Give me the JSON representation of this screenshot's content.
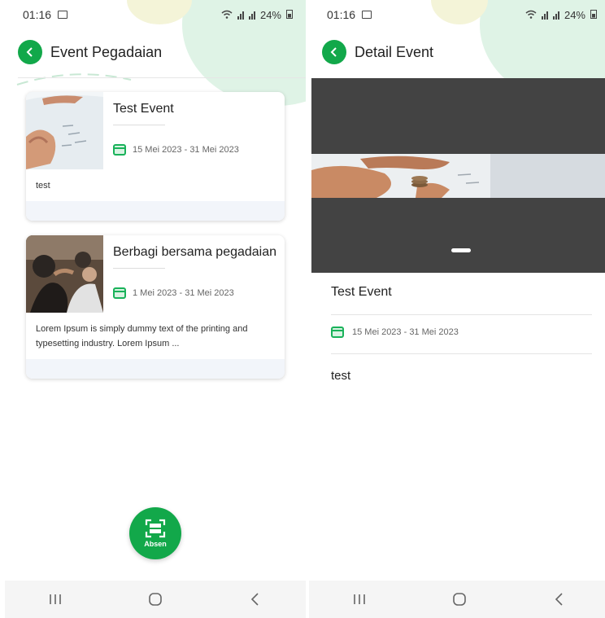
{
  "left_screen": {
    "status": {
      "time": "01:16",
      "battery": "24%"
    },
    "header": {
      "title": "Event Pegadaian"
    },
    "events": [
      {
        "title": "Test Event",
        "date": "15 Mei 2023 - 31 Mei 2023",
        "description": "test"
      },
      {
        "title": "Berbagi bersama pegadaian",
        "date": "1 Mei 2023 - 31 Mei 2023",
        "description": "Lorem Ipsum is simply dummy text of the printing and typesetting industry. Lorem Ipsum ..."
      }
    ],
    "fab": {
      "label": "Absen",
      "icon": "scan-icon"
    }
  },
  "right_screen": {
    "status": {
      "time": "01:16",
      "battery": "24%"
    },
    "header": {
      "title": "Detail Event"
    },
    "event": {
      "title": "Test Event",
      "date": "15 Mei 2023 - 31 Mei 2023",
      "description": "test"
    }
  },
  "navbar": {
    "icons": [
      "recent-apps-icon",
      "home-icon",
      "back-icon"
    ]
  },
  "colors": {
    "primary": "#12a84a",
    "banner_bg": "#434343",
    "deco_green": "#dff3e6"
  }
}
